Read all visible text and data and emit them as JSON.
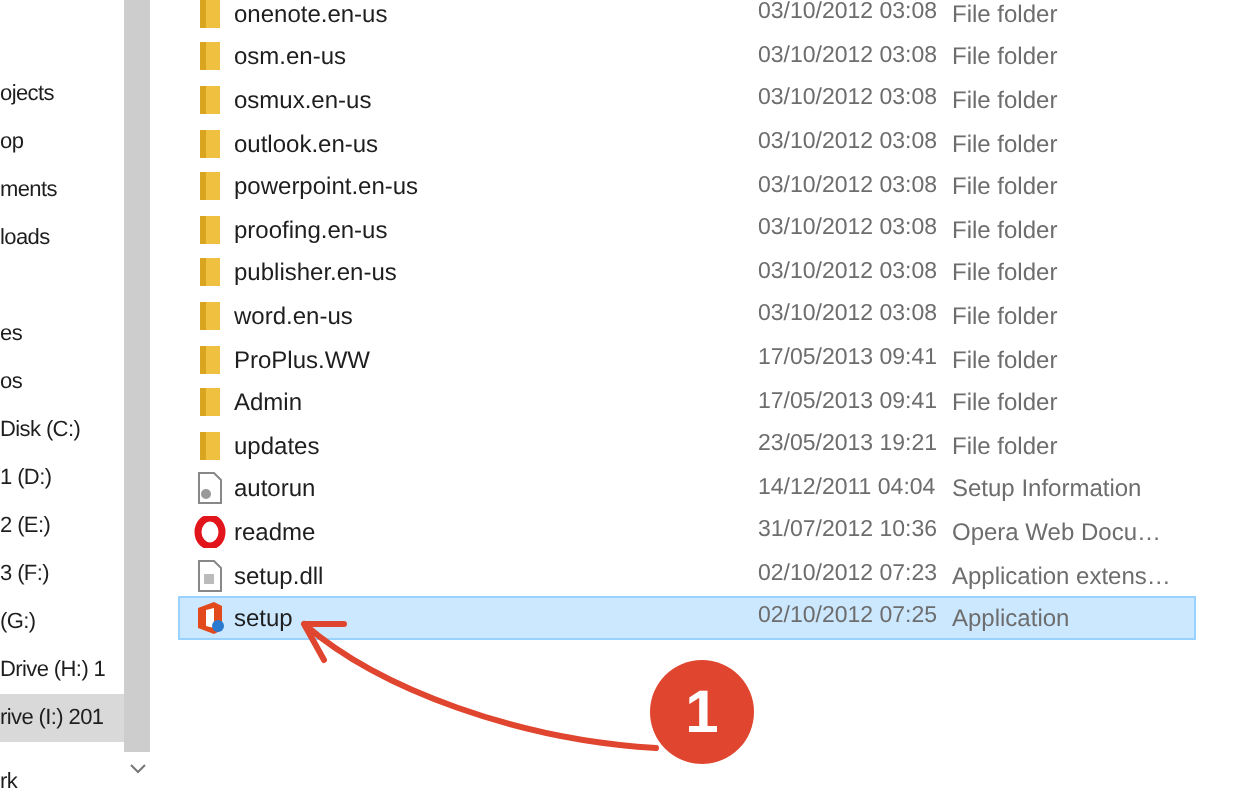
{
  "sidebar": {
    "items": [
      {
        "label": "ojects",
        "selected": false
      },
      {
        "label": "op",
        "selected": false
      },
      {
        "label": "ments",
        "selected": false
      },
      {
        "label": "loads",
        "selected": false
      },
      {
        "label": "es",
        "selected": false
      },
      {
        "label": "os",
        "selected": false
      },
      {
        "label": "Disk (C:)",
        "selected": false
      },
      {
        "label": "1 (D:)",
        "selected": false
      },
      {
        "label": "2 (E:)",
        "selected": false
      },
      {
        "label": "3 (F:)",
        "selected": false
      },
      {
        "label": "(G:)",
        "selected": false
      },
      {
        "label": "Drive (H:) 1",
        "selected": false
      },
      {
        "label": "rive (I:) 201",
        "selected": true
      },
      {
        "label": "rk",
        "selected": false
      }
    ]
  },
  "files": [
    {
      "kind": "folder",
      "name": "onenote.en-us",
      "date": "03/10/2012 03:08",
      "type": "File folder",
      "selected": false
    },
    {
      "kind": "folder",
      "name": "osm.en-us",
      "date": "03/10/2012 03:08",
      "type": "File folder",
      "selected": false
    },
    {
      "kind": "folder",
      "name": "osmux.en-us",
      "date": "03/10/2012 03:08",
      "type": "File folder",
      "selected": false
    },
    {
      "kind": "folder",
      "name": "outlook.en-us",
      "date": "03/10/2012 03:08",
      "type": "File folder",
      "selected": false
    },
    {
      "kind": "folder",
      "name": "powerpoint.en-us",
      "date": "03/10/2012 03:08",
      "type": "File folder",
      "selected": false
    },
    {
      "kind": "folder",
      "name": "proofing.en-us",
      "date": "03/10/2012 03:08",
      "type": "File folder",
      "selected": false
    },
    {
      "kind": "folder",
      "name": "publisher.en-us",
      "date": "03/10/2012 03:08",
      "type": "File folder",
      "selected": false
    },
    {
      "kind": "folder",
      "name": "word.en-us",
      "date": "03/10/2012 03:08",
      "type": "File folder",
      "selected": false
    },
    {
      "kind": "folder",
      "name": "ProPlus.WW",
      "date": "17/05/2013 09:41",
      "type": "File folder",
      "selected": false
    },
    {
      "kind": "folder",
      "name": "Admin",
      "date": "17/05/2013 09:41",
      "type": "File folder",
      "selected": false
    },
    {
      "kind": "folder",
      "name": "updates",
      "date": "23/05/2013 19:21",
      "type": "File folder",
      "selected": false
    },
    {
      "kind": "settings-file",
      "name": "autorun",
      "date": "14/12/2011 04:04",
      "type": "Setup Information",
      "selected": false
    },
    {
      "kind": "web-document",
      "name": "readme",
      "date": "31/07/2012 10:36",
      "type": "Opera Web Docu…",
      "selected": false
    },
    {
      "kind": "dll",
      "name": "setup.dll",
      "date": "02/10/2012 07:23",
      "type": "Application extens…",
      "selected": false
    },
    {
      "kind": "application",
      "name": "setup",
      "date": "02/10/2012 07:25",
      "type": "Application",
      "selected": true
    }
  ],
  "annotation": {
    "badge": "1"
  }
}
